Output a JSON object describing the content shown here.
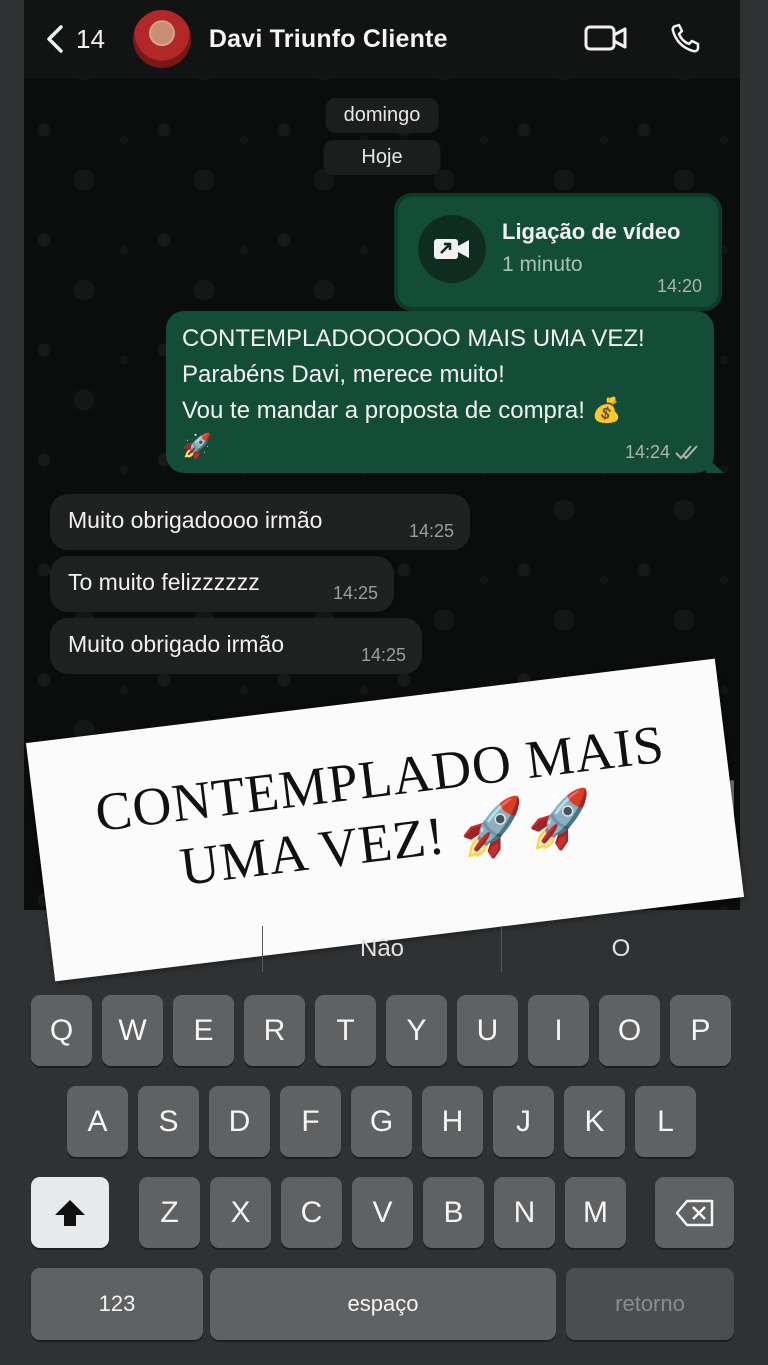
{
  "header": {
    "back_count": "14",
    "contact_name": "Davi Triunfo Cliente"
  },
  "chips": {
    "day": "domingo",
    "today": "Hoje"
  },
  "call": {
    "title": "Ligação de vídeo",
    "duration": "1 minuto",
    "time": "14:20"
  },
  "outgoing": {
    "text": "CONTEMPLADOOOOOO MAIS UMA VEZ!\nParabéns Davi, merece muito!\nVou te mandar a proposta de compra! 💰\n🚀",
    "time": "14:24"
  },
  "incoming": [
    {
      "text": "Muito obrigadoooo irmão",
      "time": "14:25"
    },
    {
      "text": "To muito felizzzzzz",
      "time": "14:25"
    },
    {
      "text": "Muito obrigado irmão",
      "time": "14:25"
    }
  ],
  "banner": {
    "text": "CONTEMPLADO MAIS UMA VEZ! 🚀🚀"
  },
  "suggestions": [
    "",
    "Não",
    "O"
  ],
  "keyboard": {
    "row1": [
      "Q",
      "W",
      "E",
      "R",
      "T",
      "Y",
      "U",
      "I",
      "O",
      "P"
    ],
    "row2": [
      "A",
      "S",
      "D",
      "F",
      "G",
      "H",
      "J",
      "K",
      "L"
    ],
    "row3": [
      "Z",
      "X",
      "C",
      "V",
      "B",
      "N",
      "M"
    ],
    "numbers": "123",
    "space": "espaço",
    "return": "retorno"
  },
  "colors": {
    "outgoing_bubble": "#144d37",
    "incoming_bubble": "#1f2121",
    "keyboard_bg": "#2f3133"
  }
}
